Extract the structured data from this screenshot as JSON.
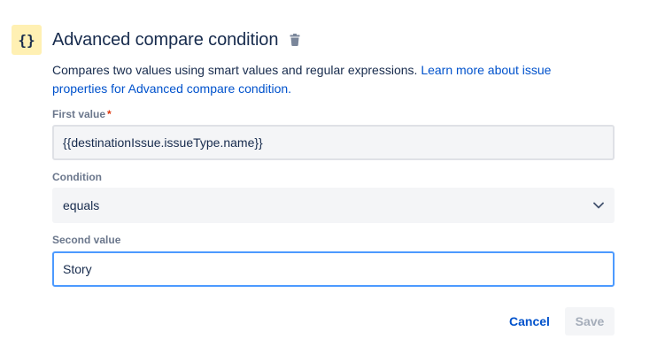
{
  "header": {
    "badge_text": "{}",
    "title": "Advanced compare condition",
    "delete_icon": "trash-icon"
  },
  "description": {
    "text": "Compares two values using smart values and regular expressions. ",
    "link_text": "Learn more about issue properties for Advanced compare condition."
  },
  "fields": {
    "first_value": {
      "label": "First value",
      "required_mark": "*",
      "value": "{{destinationIssue.issueType.name}}"
    },
    "condition": {
      "label": "Condition",
      "value": "equals",
      "icon": "chevron-down-icon"
    },
    "second_value": {
      "label": "Second value",
      "value": "Story"
    }
  },
  "actions": {
    "cancel_label": "Cancel",
    "save_label": "Save"
  },
  "colors": {
    "link": "#0052cc",
    "badge_bg": "#fff0b3",
    "focus_border": "#4c9aff",
    "required": "#de350b"
  }
}
